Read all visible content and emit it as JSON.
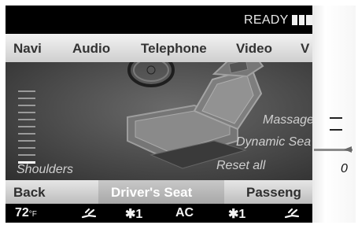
{
  "status": {
    "ready_text": "READY"
  },
  "main_menu": [
    "Navi",
    "Audio",
    "Telephone",
    "Video",
    "V"
  ],
  "content": {
    "left_label": "Shoulders",
    "options": [
      "Massage",
      "Dynamic Sea",
      "Reset all"
    ],
    "scale_ticks": 11,
    "scale_selected_index": 10
  },
  "bottom_menu": {
    "back": "Back",
    "title": "Driver's Seat",
    "passenger": "Passeng"
  },
  "climate": {
    "temperature": "72",
    "temp_unit": "°F",
    "fan_left": "1",
    "ac": "AC",
    "fan_right": "1"
  },
  "panel": {
    "value": "0"
  },
  "colors": {
    "accent_white": "#ffffff",
    "menu_bg": "#e0e0e0",
    "content_bg": "#4a4a4a"
  }
}
